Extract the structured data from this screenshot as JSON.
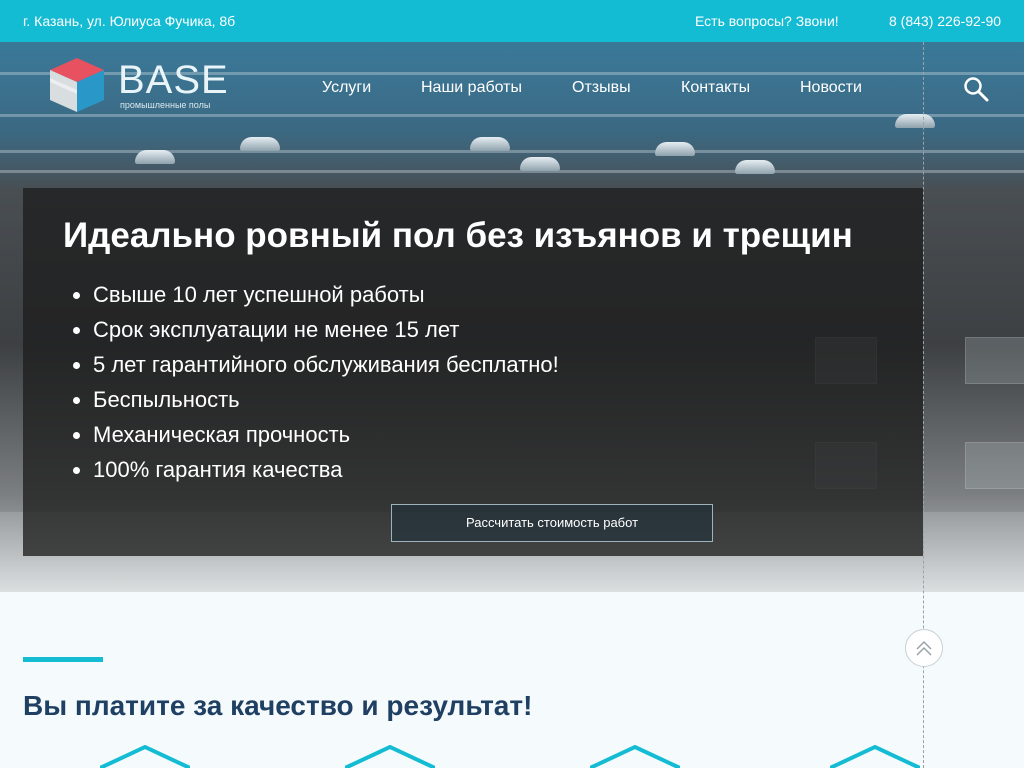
{
  "topbar": {
    "address": "г. Казань, ул. Юлиуса Фучика, 8б",
    "question": "Есть вопросы? Звони!",
    "phone": "8 (843) 226-92-90"
  },
  "logo": {
    "brand": "BASE",
    "tagline": "промышленные полы"
  },
  "nav": {
    "items": [
      {
        "label": "Услуги"
      },
      {
        "label": "Наши работы"
      },
      {
        "label": "Отзывы"
      },
      {
        "label": "Контакты"
      },
      {
        "label": "Новости"
      }
    ],
    "search_icon": "search-icon"
  },
  "hero": {
    "title": "Идеально ровный пол без изъянов и трещин",
    "bullets": [
      "Свыше 10 лет успешной работы",
      "Срок эксплуатации не менее 15 лет",
      "5 лет гарантийного обслуживания бесплатно!",
      "Беспыльность",
      "Механическая прочность",
      "100% гарантия качества"
    ],
    "cta": "Рассчитать стоимость работ"
  },
  "section": {
    "title": "Вы платите за качество и результат!"
  },
  "colors": {
    "accent": "#14bcd3",
    "heading": "#1f3f63"
  }
}
